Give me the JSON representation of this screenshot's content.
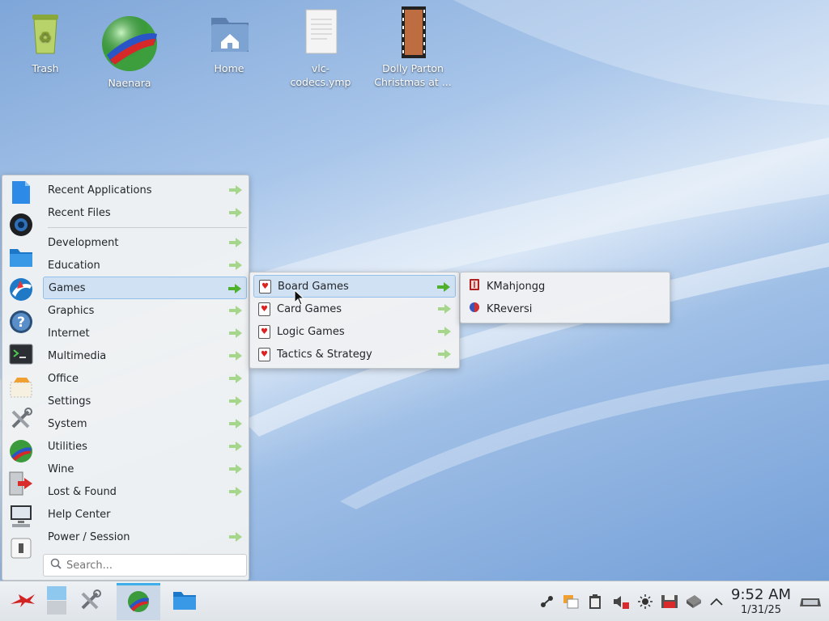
{
  "desktop": {
    "icons": [
      {
        "label": "Trash",
        "icon": "trash-icon"
      },
      {
        "label": "Naenara",
        "icon": "globe-browser-icon"
      },
      {
        "label": "Home",
        "icon": "home-folder-icon"
      },
      {
        "label": "vlc-codecs.ymp",
        "icon": "document-icon"
      },
      {
        "label": "Dolly Parton Christmas at ...",
        "icon": "video-file-icon"
      }
    ]
  },
  "start_menu": {
    "items": [
      {
        "label": "Recent Applications",
        "submenu": true
      },
      {
        "label": "Recent Files",
        "submenu": true
      },
      {
        "label": "Development",
        "submenu": true
      },
      {
        "label": "Education",
        "submenu": true
      },
      {
        "label": "Games",
        "submenu": true,
        "active": true
      },
      {
        "label": "Graphics",
        "submenu": true
      },
      {
        "label": "Internet",
        "submenu": true
      },
      {
        "label": "Multimedia",
        "submenu": true
      },
      {
        "label": "Office",
        "submenu": true
      },
      {
        "label": "Settings",
        "submenu": true
      },
      {
        "label": "System",
        "submenu": true
      },
      {
        "label": "Utilities",
        "submenu": true
      },
      {
        "label": "Wine",
        "submenu": true
      },
      {
        "label": "Lost & Found",
        "submenu": true
      },
      {
        "label": "Help Center",
        "submenu": false
      },
      {
        "label": "Power / Session",
        "submenu": true
      }
    ],
    "search_placeholder": "Search...",
    "favorites": [
      "text-editor-icon",
      "camera-icon",
      "folder-icon",
      "browser-icon",
      "help-icon",
      "terminal-icon",
      "package-icon",
      "tools-icon",
      "globe-icon",
      "logout-icon",
      "computer-icon",
      "lock-icon"
    ]
  },
  "games_submenu": {
    "items": [
      {
        "label": "Board Games",
        "active": true
      },
      {
        "label": "Card Games"
      },
      {
        "label": "Logic Games"
      },
      {
        "label": "Tactics & Strategy"
      }
    ]
  },
  "board_games_submenu": {
    "items": [
      {
        "label": "KMahjongg",
        "icon": "mahjongg-icon"
      },
      {
        "label": "KReversi",
        "icon": "reversi-icon"
      }
    ]
  },
  "taskbar": {
    "clock_time": "9:52 AM",
    "clock_date": "1/31/25"
  },
  "colors": {
    "accent": "#3daee9",
    "selection_bg": "#cfe1f3",
    "arrow_green": "#6cc24a"
  }
}
